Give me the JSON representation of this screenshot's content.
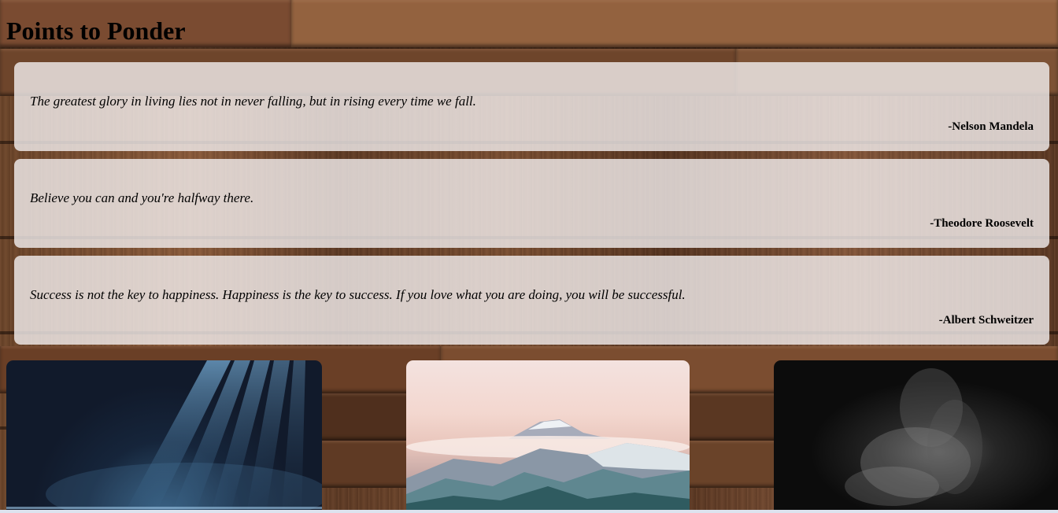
{
  "page": {
    "title": "Points to Ponder"
  },
  "quotes": [
    {
      "text": "The greatest glory in living lies not in never falling, but in rising every time we fall.",
      "author": "-Nelson Mandela"
    },
    {
      "text": "Believe you can and you're halfway there.",
      "author": "-Theodore Roosevelt"
    },
    {
      "text": "Success is not the key to happiness. Happiness is the key to success. If you love what you are doing, you will be successful.",
      "author": "-Albert Schweitzer"
    }
  ],
  "gallery": [
    {
      "name": "light-rays-photo"
    },
    {
      "name": "mountain-photo"
    },
    {
      "name": "smoke-photo"
    }
  ],
  "colors": {
    "card_background": "#f0ecec",
    "wood_background": "#5a3a26"
  }
}
